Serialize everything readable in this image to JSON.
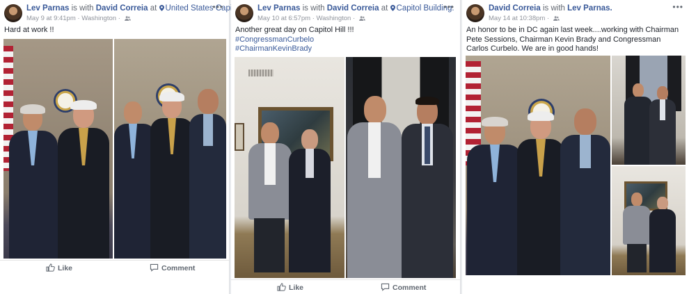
{
  "posts": [
    {
      "author": "Lev Parnas",
      "with_prefix": "is with",
      "with": "David Correia",
      "at_prefix": "at",
      "location": "United States Capitol.",
      "date": "May 9 at 9:41pm",
      "place": "Washington",
      "text": "Hard at work !!",
      "hashtags": [],
      "like_label": "Like",
      "comment_label": "Comment"
    },
    {
      "author": "Lev Parnas",
      "with_prefix": "is with",
      "with": "David Correia",
      "at_prefix": "at",
      "location": "Capitol Building.",
      "date": "May 10 at 6:57pm",
      "place": "Washington",
      "text": "Another great day on Capitol Hill !!!",
      "hashtags": [
        "#CongressmanCurbelo",
        "#ChairmanKevinBrady"
      ],
      "like_label": "Like",
      "comment_label": "Comment"
    },
    {
      "author": "David Correia",
      "with_prefix": "is with",
      "with": "Lev Parnas.",
      "date": "May 14 at 10:38pm",
      "text": "An honor to be in DC again last week....working with Chairman Pete Sessions, Chairman Kevin Brady and Congressman Carlos Curbelo. We are in good hands!",
      "hashtags": []
    }
  ],
  "ui": {
    "more_icon": "more-horizontal-icon",
    "separator": "·"
  },
  "colors": {
    "link": "#385898",
    "meta": "#90949c",
    "background": "#e9ebee"
  }
}
